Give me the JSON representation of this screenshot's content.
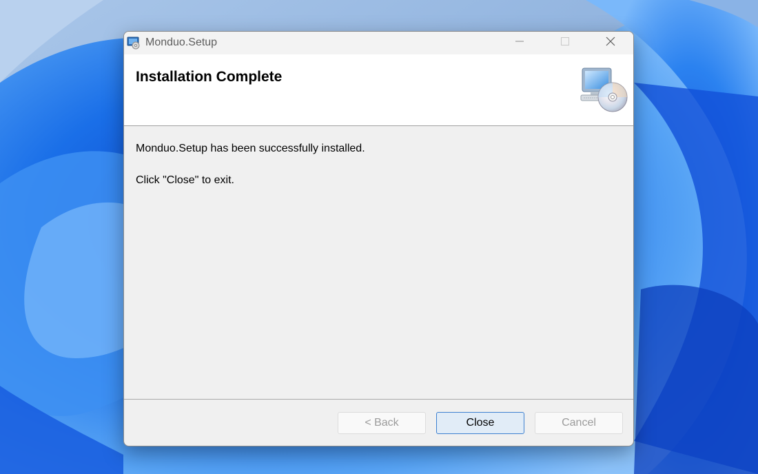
{
  "window": {
    "title": "Monduo.Setup"
  },
  "header": {
    "title": "Installation Complete"
  },
  "message": {
    "line1": "Monduo.Setup has been successfully installed.",
    "line2": "Click \"Close\" to exit."
  },
  "buttons": {
    "back": "< Back",
    "close": "Close",
    "cancel": "Cancel"
  },
  "icons": {
    "app": "setup-app-icon",
    "header": "computer-cd-icon",
    "minimize": "minimize-icon",
    "maximize": "maximize-icon",
    "close": "close-icon"
  },
  "colors": {
    "wallpaper_blue": "#1c64e0",
    "accent_border": "#3c7fd0",
    "default_button_fill": "#e1ecf7"
  }
}
